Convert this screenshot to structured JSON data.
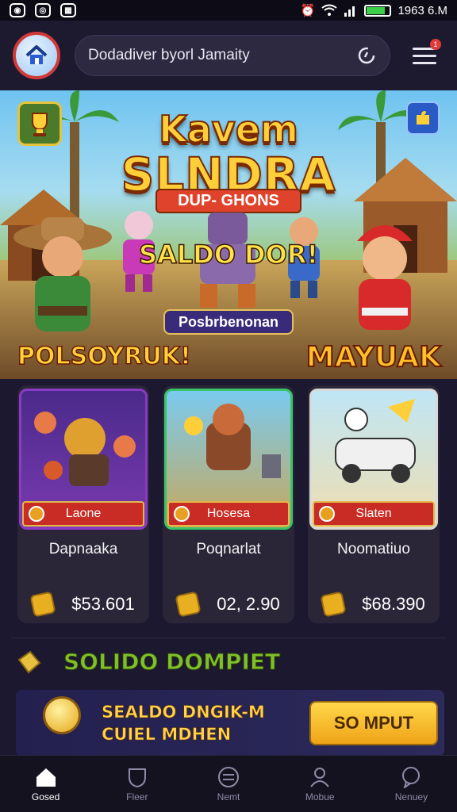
{
  "status_bar": {
    "time": "1963 6.M"
  },
  "header": {
    "search_value": "Dodadiver byorl Jamaity",
    "notification_count": "1"
  },
  "banner": {
    "title_line1": "Kavem",
    "title_line2": "SLNDRA",
    "subtitle": "DUP- GHONS",
    "saldo_text": "SALDO DOR!",
    "promo_button": "Posbrbenonan",
    "left_label": "POLSOYRUK!",
    "right_label": "MAYUAK",
    "corner_badge_text": "CHAMPION"
  },
  "cards": [
    {
      "tag": "Laone",
      "name": "Dapnaaka",
      "price": "$53.601",
      "accent": "#8a3ac4"
    },
    {
      "tag": "Hosesa",
      "name": "Poqnarlat",
      "price": "02, 2.90",
      "accent": "#3ac468"
    },
    {
      "tag": "Slaten",
      "name": "Noomatiuo",
      "price": "$68.390",
      "accent": "#d9d9d9"
    }
  ],
  "wallet": {
    "title": "SOLIDO DOMPIET",
    "line1": "SEALDO DNGIK-M",
    "line2": "CUIEL MDHEN",
    "cta": "SO MPUT"
  },
  "nav": [
    {
      "label": "Gosed",
      "icon": "home-icon"
    },
    {
      "label": "Fleer",
      "icon": "shield-icon"
    },
    {
      "label": "Nemt",
      "icon": "list-icon"
    },
    {
      "label": "Mobue",
      "icon": "user-icon"
    },
    {
      "label": "Nenuey",
      "icon": "chat-icon"
    }
  ],
  "colors": {
    "background": "#1b1830",
    "accent_gold": "#ffcf3a",
    "tag_red": "#c82c24",
    "wallet_green": "#7fc02a"
  }
}
